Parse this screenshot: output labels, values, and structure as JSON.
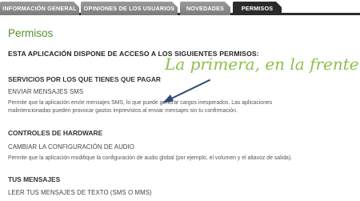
{
  "tabs": [
    {
      "label": "INFORMACIÓN GENERAL",
      "active": false
    },
    {
      "label": "OPINIONES DE LOS USUARIOS",
      "active": false
    },
    {
      "label": "NOVEDADES",
      "active": false
    },
    {
      "label": "PERMISOS",
      "active": true
    }
  ],
  "page": {
    "title": "Permisos",
    "intro": "ESTA APLICACIÓN DISPONE DE ACCESO A LOS SIGUIENTES PERMISOS:"
  },
  "sections": [
    {
      "heading": "SERVICIOS POR LOS QUE TIENES QUE PAGAR",
      "permission": "ENVIAR MENSAJES SMS",
      "description_line1": "Permite que la aplicación envíe mensajes SMS, lo que puede generar cargos inesperados. Las aplicaciones",
      "description_line2": "malintencionadas pueden provocar gastos imprevistos al enviar mensajes sin tu confirmación."
    },
    {
      "heading": "CONTROLES DE HARDWARE",
      "permission": "CAMBIAR LA CONFIGURACIÓN DE AUDIO",
      "description_line1": "Permite que la aplicación modifique la configuración de audio global (por ejemplo, el volumen y el altavoz de salida)."
    },
    {
      "heading": "TUS MENSAJES",
      "permission": "LEER TUS MENSAJES DE TEXTO (SMS O MMS)"
    }
  ],
  "annotation": {
    "text": "La primera, en la frente",
    "color": "#8cc04a"
  },
  "colors": {
    "accent_green": "#5a8f2a",
    "tab_active": "#2b2b2b",
    "tab_inactive": "#8a8a8a"
  }
}
